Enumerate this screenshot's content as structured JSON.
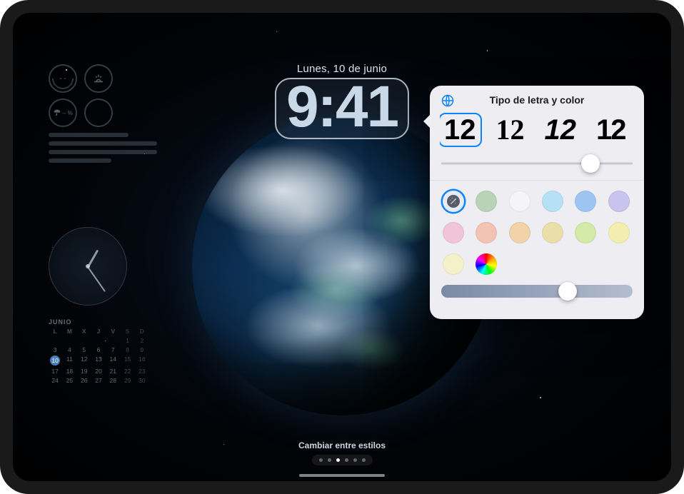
{
  "device": "iPad",
  "lockscreen": {
    "date": "Lunes, 10 de junio",
    "time": "9:41"
  },
  "left_widgets": {
    "circles": [
      {
        "name": "gauge-temp",
        "value": "- -"
      },
      {
        "name": "sunrise",
        "value": ""
      },
      {
        "name": "precip",
        "value": "-- %"
      },
      {
        "name": "empty",
        "value": ""
      }
    ]
  },
  "calendar": {
    "month": "JUNIO",
    "dow": [
      "L",
      "M",
      "X",
      "J",
      "V",
      "S",
      "D"
    ],
    "weeks": [
      [
        "",
        "",
        "",
        "",
        "",
        "1",
        "2"
      ],
      [
        "3",
        "4",
        "5",
        "6",
        "7",
        "8",
        "9"
      ],
      [
        "10",
        "11",
        "12",
        "13",
        "14",
        "15",
        "16"
      ],
      [
        "17",
        "18",
        "19",
        "20",
        "21",
        "22",
        "23"
      ],
      [
        "24",
        "25",
        "26",
        "27",
        "28",
        "29",
        "30"
      ]
    ],
    "today": "10"
  },
  "style_switch": {
    "label": "Cambiar entre estilos",
    "count": 6,
    "active_index": 2
  },
  "popover": {
    "title": "Tipo de letra y color",
    "font_samples": [
      "12",
      "12",
      "12",
      "12"
    ],
    "selected_font_index": 0,
    "weight_slider": {
      "value": 0.78
    },
    "tint_slider": {
      "value": 0.66
    },
    "colors": [
      {
        "name": "dynamic-wand",
        "hex": "#e7ecf4",
        "selected": true,
        "icon": "wand"
      },
      {
        "name": "sage",
        "hex": "#b9d3b8"
      },
      {
        "name": "white",
        "hex": "#f5f5f7"
      },
      {
        "name": "sky",
        "hex": "#b7e0f7"
      },
      {
        "name": "blue",
        "hex": "#9ec5f2"
      },
      {
        "name": "lavender",
        "hex": "#c9c3ef"
      },
      {
        "name": "pink",
        "hex": "#f2c4dc"
      },
      {
        "name": "coral",
        "hex": "#f2c2b3"
      },
      {
        "name": "peach",
        "hex": "#f2d2a8"
      },
      {
        "name": "sand",
        "hex": "#eadfab"
      },
      {
        "name": "mint",
        "hex": "#d2e9a8"
      },
      {
        "name": "butter",
        "hex": "#f3edb1"
      },
      {
        "name": "cream",
        "hex": "#f4f0c8"
      },
      {
        "name": "rainbow",
        "hex": "rainbow"
      }
    ]
  }
}
